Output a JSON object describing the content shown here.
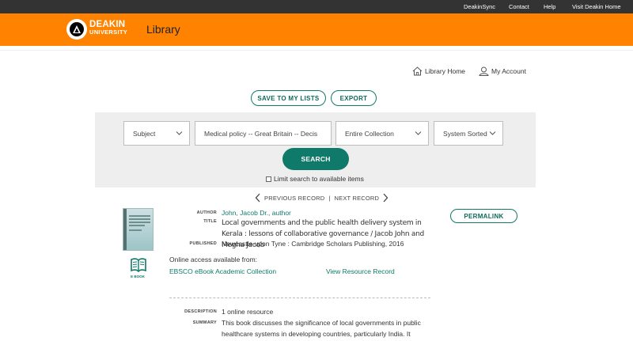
{
  "topbar": {
    "links": [
      "DeakinSync",
      "Contact",
      "Help",
      "Visit Deakin Home"
    ]
  },
  "header": {
    "logo_line1": "DEAKIN",
    "logo_line2": "UNIVERSITY",
    "title": "Library"
  },
  "account_links": {
    "library_home": "Library Home",
    "my_account": "My Account"
  },
  "actions": {
    "save": "SAVE TO MY LISTS",
    "export": "EXPORT"
  },
  "search": {
    "field_type": "Subject",
    "query": "Medical policy -- Great Britain -- Decis",
    "scope": "Entire Collection",
    "sort": "System Sorted",
    "button": "SEARCH",
    "limit_label": "Limit search to available items",
    "limit_checked": false
  },
  "record_nav": {
    "previous": "PREVIOUS RECORD",
    "separator": "|",
    "next": "NEXT RECORD"
  },
  "record": {
    "format_label": "E BOOK",
    "permalink": "PERMALINK",
    "author_label": "AUTHOR",
    "author": "John, Jacob Dr., author",
    "title_label": "TITLE",
    "title": "Local governments and the public health delivery system in Kerala : lessons of collaborative governance / Jacob John and Megha Jacob",
    "published_label": "PUBLISHED",
    "published": "Newcastle upon Tyne : Cambridge Scholars Publishing, 2016",
    "online_access": "Online access available from:",
    "collection": "EBSCO eBook Academic Collection",
    "view_resource": "View Resource Record",
    "description_label": "DESCRIPTION",
    "description": "1 online resource",
    "summary_label": "SUMMARY",
    "summary_line1": "This book discusses the significance of local governments in public",
    "summary_line2": "healthcare systems in developing countries, particularly India. It"
  },
  "colors": {
    "brand_orange": "#ff8200",
    "accent_teal": "#0f7a6a",
    "topbar": "#333333"
  },
  "icons": [
    "deakin-logo",
    "home-icon",
    "user-icon",
    "chevron-down-icon",
    "chevron-left-icon",
    "chevron-right-icon",
    "ebook-icon"
  ]
}
